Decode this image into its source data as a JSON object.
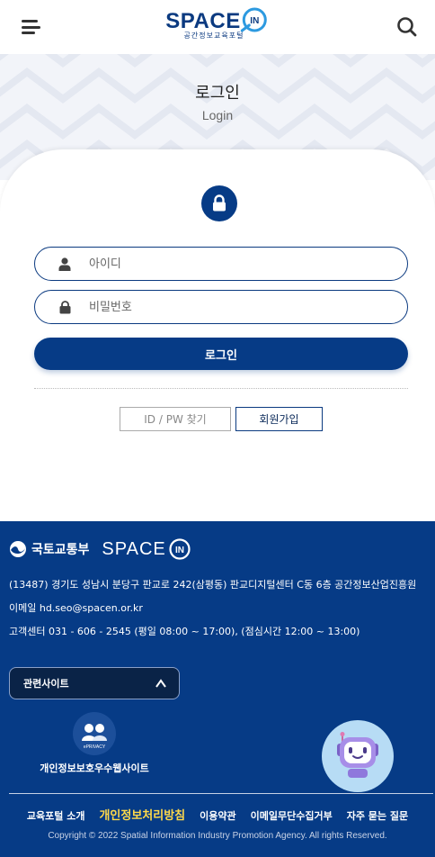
{
  "header": {
    "logo_text": "SPACE",
    "logo_in": "IN",
    "logo_sub": "공간정보교육포털",
    "menu_icon": "hamburger-icon",
    "search_icon": "search-icon"
  },
  "hero": {
    "title": "로그인",
    "subtitle": "Login"
  },
  "login": {
    "lock_icon": "lock-icon",
    "id_placeholder": "아이디",
    "pw_placeholder": "비밀번호",
    "submit_label": "로그인",
    "find_label": "ID / PW 찾기",
    "join_label": "회원가입"
  },
  "footer": {
    "ministry": "국토교통부",
    "space_text": "SPACE",
    "space_in": "IN",
    "address": "(13487) 경기도 성남시 분당구 판교로 242(삼평동) 판교디지털센터 C동 6층 공간정보산업진흥원",
    "email": "이메일 hd.seo@spacen.or.kr",
    "tel": "고객센터 031 - 606 - 2545 (평일 08:00 ~ 17:00), (점심시간 12:00 ~ 13:00)",
    "related_label": "관련사이트",
    "privacy_site_label": "개인정보보호우수웹사이트",
    "privacy_badge_text": "ePRIVACY",
    "links": [
      "교육포털 소개",
      "개인정보처리방침",
      "이용약관",
      "이메일무단수집거부",
      "자주 묻는 질문"
    ],
    "copyright": "Copyright © 2022 Spatial Information Industry Promotion Agency. All rights Reserved."
  },
  "colors": {
    "brand": "#063b86",
    "highlight_link": "#ffd94a",
    "chatbot_bg": "#b7dcf5"
  }
}
